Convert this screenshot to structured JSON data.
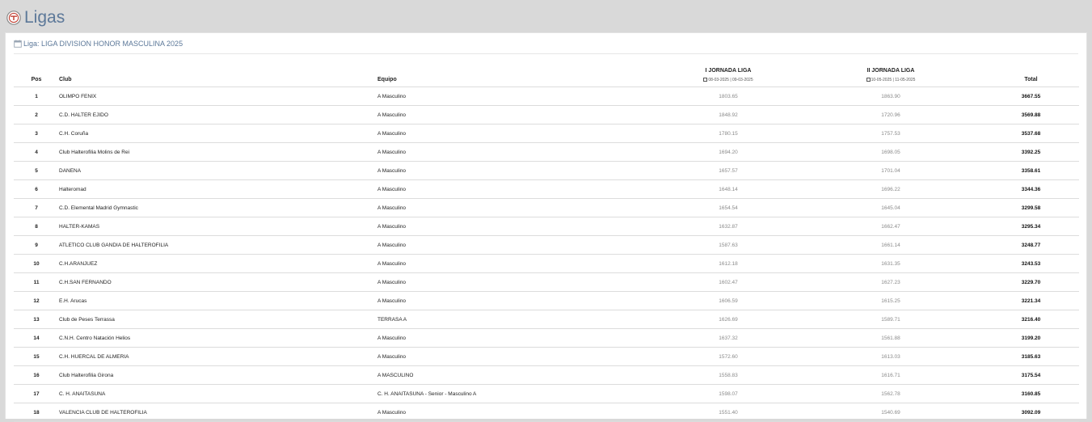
{
  "page": {
    "title": "Ligas",
    "liga_label": "Liga: LIGA DIVISION HONOR MASCULINA 2025",
    "colors": {
      "title": "#5c7899",
      "background": "#d9d9d9",
      "panel": "#ffffff"
    }
  },
  "table": {
    "headers": {
      "pos": "Pos",
      "club": "Club",
      "equipo": "Equipo",
      "j1_name": "I JORNADA LIGA",
      "j1_dates": "08-03-2025 | 09-03-2025",
      "j2_name": "II JORNADA LIGA",
      "j2_dates": "10-05-2025 | 11-05-2025",
      "total": "Total"
    },
    "rows": [
      {
        "pos": "1",
        "club": "OLIMPO FENIX",
        "equipo": "A Masculino",
        "j1": "1803.65",
        "j2": "1863.90",
        "total": "3667.55"
      },
      {
        "pos": "2",
        "club": "C.D. HALTER EJIDO",
        "equipo": "A Masculino",
        "j1": "1848.92",
        "j2": "1720.96",
        "total": "3569.88"
      },
      {
        "pos": "3",
        "club": "C.H. Coruña",
        "equipo": "A Masculino",
        "j1": "1780.15",
        "j2": "1757.53",
        "total": "3537.68"
      },
      {
        "pos": "4",
        "club": "Club Halterofilia Molins de Rei",
        "equipo": "A Masculino",
        "j1": "1694.20",
        "j2": "1698.05",
        "total": "3392.25"
      },
      {
        "pos": "5",
        "club": "DANENA",
        "equipo": "A Masculino",
        "j1": "1657.57",
        "j2": "1701.04",
        "total": "3358.61"
      },
      {
        "pos": "6",
        "club": "Halteromad",
        "equipo": "A Masculino",
        "j1": "1648.14",
        "j2": "1696.22",
        "total": "3344.36"
      },
      {
        "pos": "7",
        "club": "C.D. Elemental Madrid Gymnastic",
        "equipo": "A Masculino",
        "j1": "1654.54",
        "j2": "1645.04",
        "total": "3299.58"
      },
      {
        "pos": "8",
        "club": "HALTER-KAMAS",
        "equipo": "A Masculino",
        "j1": "1632.87",
        "j2": "1662.47",
        "total": "3295.34"
      },
      {
        "pos": "9",
        "club": "ATLETICO CLUB GANDIA DE HALTEROFILIA",
        "equipo": "A Masculino",
        "j1": "1587.63",
        "j2": "1661.14",
        "total": "3248.77"
      },
      {
        "pos": "10",
        "club": "C.H.ARANJUEZ",
        "equipo": "A Masculino",
        "j1": "1612.18",
        "j2": "1631.35",
        "total": "3243.53"
      },
      {
        "pos": "11",
        "club": "C.H.SAN FERNANDO",
        "equipo": "A Masculino",
        "j1": "1602.47",
        "j2": "1627.23",
        "total": "3229.70"
      },
      {
        "pos": "12",
        "club": "E.H. Arucas",
        "equipo": "A Masculino",
        "j1": "1606.59",
        "j2": "1615.25",
        "total": "3221.34"
      },
      {
        "pos": "13",
        "club": "Club de Peses Terrassa",
        "equipo": "TERRASA A",
        "j1": "1626.69",
        "j2": "1589.71",
        "total": "3216.40"
      },
      {
        "pos": "14",
        "club": "C.N.H. Centro Natación Helios",
        "equipo": "A Masculino",
        "j1": "1637.32",
        "j2": "1561.88",
        "total": "3199.20"
      },
      {
        "pos": "15",
        "club": "C.H. HUERCAL DE ALMERIA",
        "equipo": "A Masculino",
        "j1": "1572.60",
        "j2": "1613.03",
        "total": "3185.63"
      },
      {
        "pos": "16",
        "club": "Club Halterofilia Girona",
        "equipo": "A MASCULINO",
        "j1": "1558.83",
        "j2": "1616.71",
        "total": "3175.54"
      },
      {
        "pos": "17",
        "club": "C. H. ANAITASUNA",
        "equipo": "C. H. ANAITASUNA - Senior - Masculino A",
        "j1": "1598.07",
        "j2": "1562.78",
        "total": "3160.85"
      },
      {
        "pos": "18",
        "club": "VALENCIA CLUB DE HALTEROFILIA",
        "equipo": "A Masculino",
        "j1": "1551.40",
        "j2": "1540.69",
        "total": "3092.09"
      }
    ]
  }
}
